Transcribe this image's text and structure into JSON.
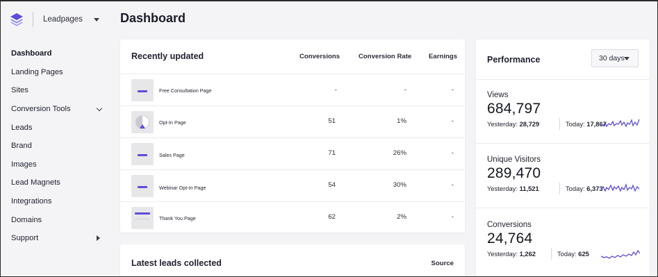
{
  "app": {
    "brand": "Leadpages",
    "brand_color": "#5b4ed8"
  },
  "sidebar": {
    "items": [
      {
        "label": "Dashboard",
        "active": true
      },
      {
        "label": "Landing Pages"
      },
      {
        "label": "Sites"
      },
      {
        "label": "Conversion Tools",
        "icon": "chevron-down-icon"
      },
      {
        "label": "Leads"
      },
      {
        "label": "Brand"
      },
      {
        "label": "Images"
      },
      {
        "label": "Lead Magnets"
      },
      {
        "label": "Integrations"
      },
      {
        "label": "Domains"
      },
      {
        "label": "Support",
        "icon": "triangle-right-icon"
      }
    ]
  },
  "header": {
    "title": "Dashboard"
  },
  "recent": {
    "title": "Recently updated",
    "columns": [
      "Conversions",
      "Conversion Rate",
      "Earnings"
    ],
    "rows": [
      {
        "name": "Free Consultation Page",
        "thumb": "bar-thumbnail-icon",
        "conversions": "-",
        "rate": "-",
        "earnings": "-"
      },
      {
        "name": "Opt-In Page",
        "thumb": "pie-thumbnail-icon",
        "conversions": "51",
        "rate": "1%",
        "earnings": "-"
      },
      {
        "name": "Sales Page",
        "thumb": "bar-thumbnail-icon",
        "conversions": "71",
        "rate": "26%",
        "earnings": "-"
      },
      {
        "name": "Webinar Opt-In Page",
        "thumb": "bar-thumbnail-icon",
        "conversions": "54",
        "rate": "30%",
        "earnings": "-"
      },
      {
        "name": "Thank You Page",
        "thumb": "wide-bar-thumbnail-icon",
        "conversions": "62",
        "rate": "2%",
        "earnings": "-"
      }
    ]
  },
  "leads": {
    "title": "Latest leads collected",
    "source_label": "Source"
  },
  "performance": {
    "title": "Performance",
    "range": "30 days",
    "metrics": [
      {
        "label": "Views",
        "value": "684,797",
        "yesterday_label": "Yesterday:",
        "yesterday": "28,729",
        "today_label": "Today:",
        "today": "17,867"
      },
      {
        "label": "Unique Visitors",
        "value": "289,470",
        "yesterday_label": "Yesterday:",
        "yesterday": "11,521",
        "today_label": "Today:",
        "today": "6,373"
      },
      {
        "label": "Conversions",
        "value": "24,764",
        "yesterday_label": "Yesterday:",
        "yesterday": "1,262",
        "today_label": "Today:",
        "today": "625"
      }
    ]
  }
}
